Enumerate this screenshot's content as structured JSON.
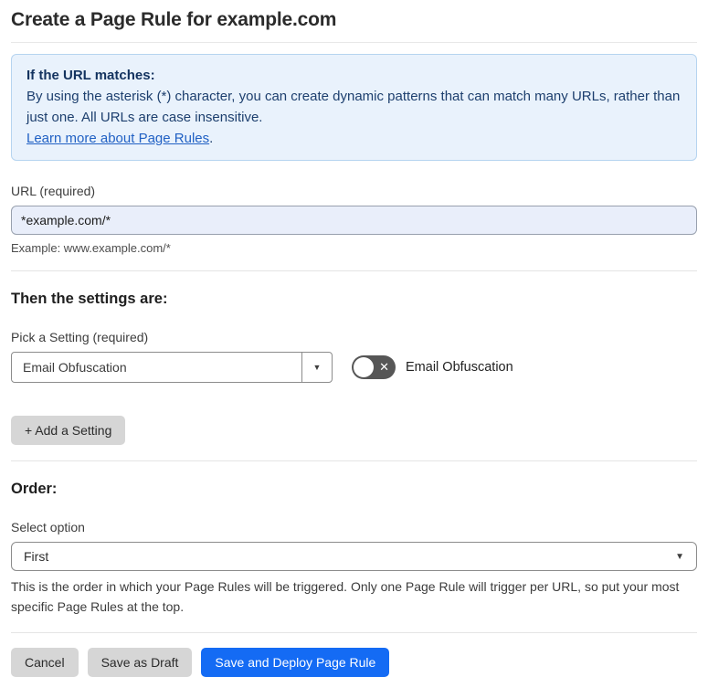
{
  "page": {
    "title": "Create a Page Rule for example.com"
  },
  "info_box": {
    "heading": "If the URL matches:",
    "body": "By using the asterisk (*) character, you can create dynamic patterns that can match many URLs, rather than just one. All URLs are case insensitive.",
    "link_label": "Learn more about Page Rules",
    "link_suffix": "."
  },
  "url_section": {
    "label": "URL (required)",
    "value": "*example.com/*",
    "example": "Example: www.example.com/*"
  },
  "settings_section": {
    "heading": "Then the settings are:",
    "picker_label": "Pick a Setting (required)",
    "picker_value": "Email Obfuscation",
    "toggle": {
      "state": "off",
      "label": "Email Obfuscation"
    },
    "add_button_label": "+ Add a Setting"
  },
  "order_section": {
    "heading": "Order:",
    "select_label": "Select option",
    "select_value": "First",
    "help_text": "This is the order in which your Page Rules will be triggered. Only one Page Rule will trigger per URL, so put your most specific Page Rules at the top."
  },
  "footer": {
    "cancel_label": "Cancel",
    "save_draft_label": "Save as Draft",
    "save_deploy_label": "Save and Deploy Page Rule"
  },
  "icons": {
    "caret_down": "▼",
    "toggle_x": "✕"
  },
  "colors": {
    "primary_blue": "#146bf4",
    "info_bg": "#e9f2fc",
    "info_border": "#b6d4f0",
    "info_text": "#1d3f6e",
    "link_blue": "#2161c4",
    "input_highlight_bg": "#e9eefa",
    "button_gray": "#d6d6d6",
    "toggle_off_gray": "#565656"
  }
}
